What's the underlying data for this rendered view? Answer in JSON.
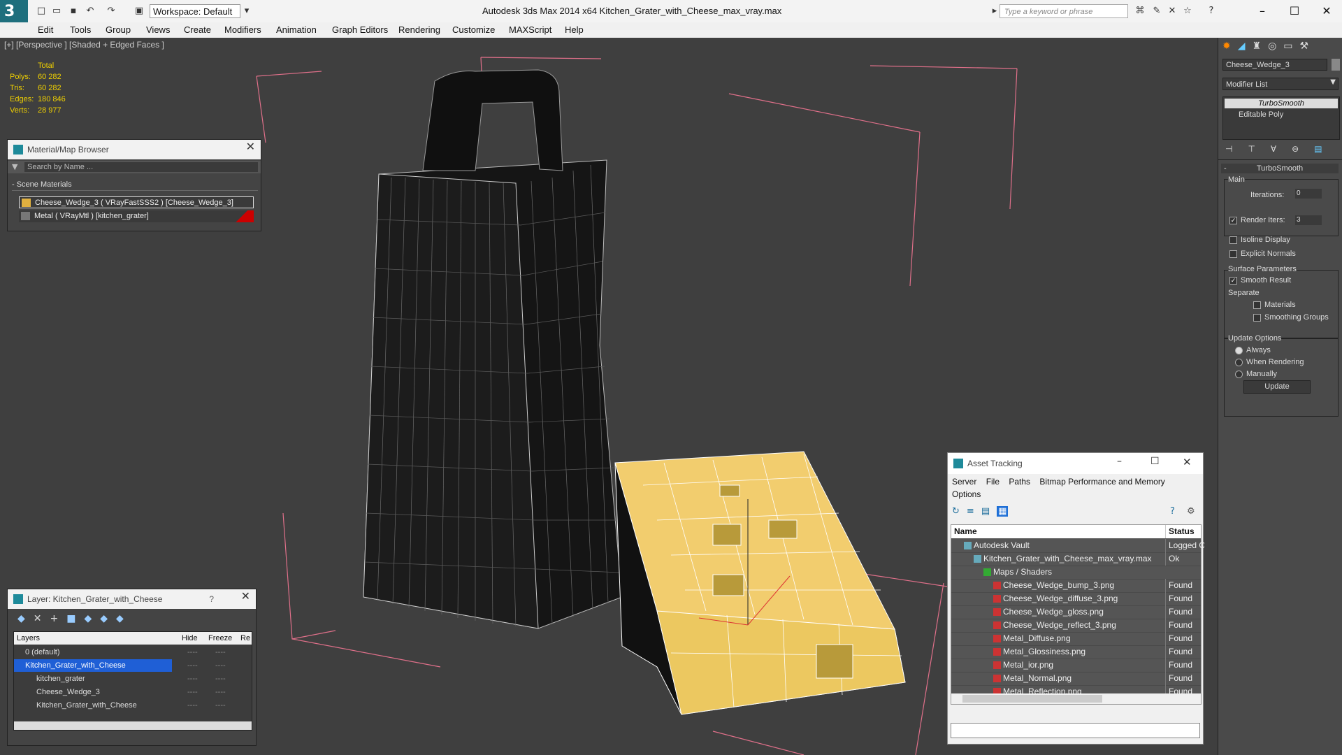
{
  "titlebar": {
    "workspace": "Workspace: Default",
    "title": "Autodesk 3ds Max  2014 x64      Kitchen_Grater_with_Cheese_max_vray.max",
    "search_placeholder": "Type a keyword or phrase",
    "minimize": "–",
    "maximize": "☐",
    "close": "✕"
  },
  "menu": [
    "Edit",
    "Tools",
    "Group",
    "Views",
    "Create",
    "Modifiers",
    "Animation",
    "Graph Editors",
    "Rendering",
    "Customize",
    "MAXScript",
    "Help"
  ],
  "viewport": {
    "label": "[+] [Perspective ] [Shaded + Edged Faces ]",
    "stats": {
      "header": "Total",
      "rows": [
        {
          "label": "Polys:",
          "value": "60 282"
        },
        {
          "label": "Tris:",
          "value": "60 282"
        },
        {
          "label": "Edges:",
          "value": "180 846"
        },
        {
          "label": "Verts:",
          "value": "28 977"
        }
      ]
    }
  },
  "material_browser": {
    "title": "Material/Map Browser",
    "search": "Search by Name ...",
    "section": "- Scene Materials",
    "items": [
      "Cheese_Wedge_3  ( VRayFastSSS2 )  [Cheese_Wedge_3]",
      "Metal  ( VRayMtl )  [kitchen_grater]"
    ]
  },
  "layer_panel": {
    "title": "Layer: Kitchen_Grater_with_Cheese",
    "help": "?",
    "columns": [
      "Layers",
      "Hide",
      "Freeze",
      "Re"
    ],
    "rows": [
      {
        "name": "0 (default)",
        "indent": 1
      },
      {
        "name": "Kitchen_Grater_with_Cheese",
        "indent": 1,
        "selected": true
      },
      {
        "name": "kitchen_grater",
        "indent": 2
      },
      {
        "name": "Cheese_Wedge_3",
        "indent": 2
      },
      {
        "name": "Kitchen_Grater_with_Cheese",
        "indent": 2
      }
    ],
    "dash": "----"
  },
  "asset_tracking": {
    "title": "Asset Tracking",
    "menu": [
      "Server",
      "File",
      "Paths",
      "Bitmap Performance and Memory"
    ],
    "menu2": "Options",
    "columns": [
      "Name",
      "Status"
    ],
    "rows": [
      {
        "name": "Autodesk Vault",
        "status": "Logged O",
        "indent": 1
      },
      {
        "name": "Kitchen_Grater_with_Cheese_max_vray.max",
        "status": "Ok",
        "indent": 2
      },
      {
        "name": "Maps / Shaders",
        "status": "",
        "indent": 3
      },
      {
        "name": "Cheese_Wedge_bump_3.png",
        "status": "Found",
        "indent": 4
      },
      {
        "name": "Cheese_Wedge_diffuse_3.png",
        "status": "Found",
        "indent": 4
      },
      {
        "name": "Cheese_Wedge_gloss.png",
        "status": "Found",
        "indent": 4
      },
      {
        "name": "Cheese_Wedge_reflect_3.png",
        "status": "Found",
        "indent": 4
      },
      {
        "name": "Metal_Diffuse.png",
        "status": "Found",
        "indent": 4
      },
      {
        "name": "Metal_Glossiness.png",
        "status": "Found",
        "indent": 4
      },
      {
        "name": "Metal_ior.png",
        "status": "Found",
        "indent": 4
      },
      {
        "name": "Metal_Normal.png",
        "status": "Found",
        "indent": 4
      },
      {
        "name": "Metal_Reflection.png",
        "status": "Found",
        "indent": 4
      }
    ]
  },
  "command_panel": {
    "object_name": "Cheese_Wedge_3",
    "modifier_list": "Modifier List",
    "stack": [
      "TurboSmooth",
      "Editable Poly"
    ],
    "rollout": "TurboSmooth",
    "main": "Main",
    "iterations_label": "Iterations:",
    "iterations": "0",
    "render_iters_label": "Render Iters:",
    "render_iters": "3",
    "isoline": "Isoline Display",
    "explicit": "Explicit Normals",
    "surface": "Surface Parameters",
    "smooth": "Smooth Result",
    "separate": "Separate",
    "materials": "Materials",
    "smoothing": "Smoothing Groups",
    "update_options": "Update Options",
    "always": "Always",
    "when_rendering": "When Rendering",
    "manually": "Manually",
    "update": "Update"
  },
  "colors": {
    "accent": "#1e6f7d",
    "stats": "#f0d000",
    "cheese": "#f2cd6e",
    "selection": "#1f5fd6"
  }
}
